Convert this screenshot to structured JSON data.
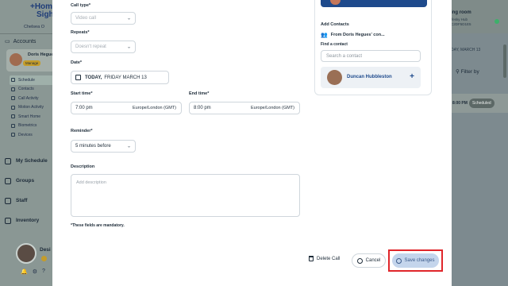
{
  "app": {
    "logo_line1": "+Home",
    "logo_line2": "Sight",
    "org_name": "Chelsea O",
    "accounts_label": "Accounts",
    "account": {
      "name": "Doris Hegues",
      "badge": "Manage"
    },
    "menu": [
      {
        "label": "Schedule"
      },
      {
        "label": "Contacts"
      },
      {
        "label": "Call Activity"
      },
      {
        "label": "Motion Activity"
      },
      {
        "label": "Smart Home"
      },
      {
        "label": "Biometrics"
      },
      {
        "label": "Devices"
      }
    ],
    "nav": [
      {
        "label": "My Schedule"
      },
      {
        "label": "Groups"
      },
      {
        "label": "Staff"
      },
      {
        "label": "Inventory"
      }
    ],
    "user_name": "Desi",
    "right": {
      "room_title": "ing room",
      "room_sub1": "ifesky Hub",
      "room_sub2": "C2DF5D1E5",
      "date": "DAY, MARCH 13",
      "filter": "Filter by",
      "time": "8:00 PM",
      "status": "Scheduled"
    }
  },
  "modal": {
    "call_type": {
      "label": "Call type*",
      "value": "Video call"
    },
    "repeats": {
      "label": "Repeats*",
      "placeholder": "Doesn't repeat"
    },
    "date": {
      "label": "Date*",
      "prefix": "TODAY,",
      "value": "FRIDAY MARCH 13"
    },
    "start_time": {
      "label": "Start time*",
      "value": "7:00 pm",
      "timezone": "Europe/London (GMT)"
    },
    "end_time": {
      "label": "End time*",
      "value": "8:00 pm",
      "timezone": "Europe/London (GMT)"
    },
    "reminder": {
      "label": "Reminder*",
      "value": "5 minutes before"
    },
    "description": {
      "label": "Description",
      "placeholder": "Add description"
    },
    "mandatory_note": "*These fields are mandatory.",
    "contacts": {
      "add_label": "Add Contacts",
      "from_label": "From Doris Hegues' con...",
      "find_label": "Find a contact",
      "find_placeholder": "Search a contact",
      "contact_name": "Duncan Hubbleston",
      "add_symbol": "+"
    },
    "buttons": {
      "delete": "Delete Call",
      "cancel": "Cancel",
      "save": "Save changes"
    }
  },
  "colors": {
    "brand_blue": "#1e4a8c",
    "highlight_red": "#e0262b",
    "save_bg": "#c4d5ec"
  }
}
